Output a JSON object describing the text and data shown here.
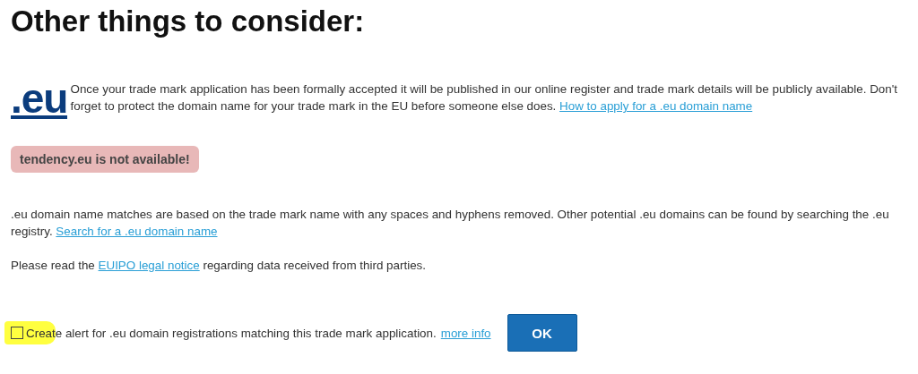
{
  "heading": "Other things to consider:",
  "intro": {
    "logo": ".eu",
    "text": "Once your trade mark application has been formally accepted it will be published in our online register and trade mark details will be publicly available. Don't forget to protect the domain name for your trade mark in the EU before someone else does.",
    "link": "How to apply for a .eu domain name"
  },
  "availability": {
    "message": "tendency.eu is not available!",
    "available": false
  },
  "matches": {
    "text": ".eu domain name matches are based on the trade mark name with any spaces and hyphens removed. Other potential .eu domains can be found by searching the .eu registry.",
    "link": "Search for a .eu domain name"
  },
  "notice": {
    "before": "Please read the",
    "link": "EUIPO legal notice",
    "after": "regarding data received from third parties."
  },
  "alert": {
    "checked": false,
    "highlighted": true,
    "label": "Create alert for .eu domain registrations matching this trade mark application.",
    "link": "more info"
  },
  "ok_button": "OK"
}
